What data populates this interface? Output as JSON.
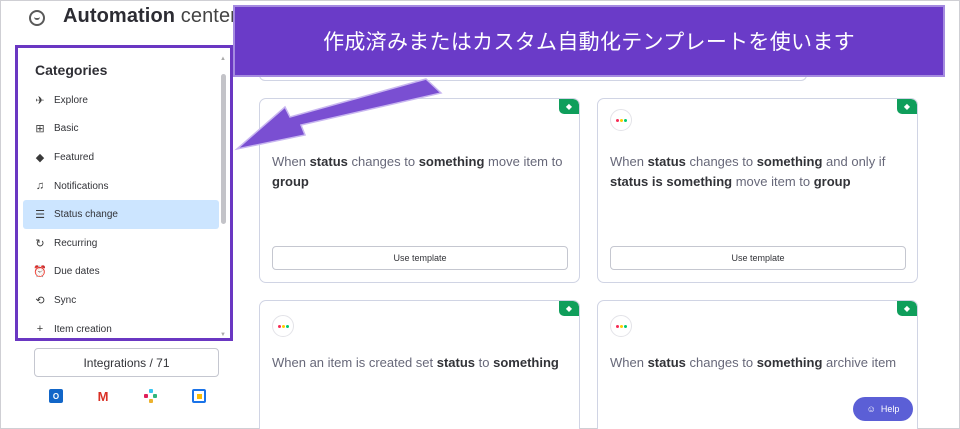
{
  "header": {
    "title_bold": "Automation",
    "title_rest": " center"
  },
  "banner": {
    "text": "作成済みまたはカスタム自動化テンプレートを使います"
  },
  "sidebar": {
    "title": "Categories",
    "items": [
      {
        "label": "Explore",
        "icon": "rocket-icon",
        "glyph": "✈"
      },
      {
        "label": "Basic",
        "icon": "hierarchy-icon",
        "glyph": "⊞"
      },
      {
        "label": "Featured",
        "icon": "diamond-icon",
        "glyph": "◆"
      },
      {
        "label": "Notifications",
        "icon": "bell-icon",
        "glyph": "♫"
      },
      {
        "label": "Status change",
        "icon": "status-list-icon",
        "glyph": "☰",
        "active": true
      },
      {
        "label": "Recurring",
        "icon": "recurring-icon",
        "glyph": "↻"
      },
      {
        "label": "Due dates",
        "icon": "alarm-clock-icon",
        "glyph": "⏰"
      },
      {
        "label": "Sync",
        "icon": "sync-icon",
        "glyph": "⟲"
      },
      {
        "label": "Item creation",
        "icon": "plus-icon",
        "glyph": "+"
      }
    ]
  },
  "integrations": {
    "label": "Integrations / 71"
  },
  "apps": [
    "outlook-icon",
    "gmail-icon",
    "slack-icon",
    "google-calendar-icon"
  ],
  "cards": [
    {
      "parts": [
        [
          "When ",
          false
        ],
        [
          "status",
          true
        ],
        [
          " changes to ",
          false
        ],
        [
          "something",
          true
        ],
        [
          " move item to ",
          false
        ],
        [
          "group",
          true
        ]
      ],
      "button": "Use template"
    },
    {
      "parts": [
        [
          "When ",
          false
        ],
        [
          "status",
          true
        ],
        [
          " changes to ",
          false
        ],
        [
          "something",
          true
        ],
        [
          " and only if ",
          false
        ],
        [
          "status is something",
          true
        ],
        [
          " move item to ",
          false
        ],
        [
          "group",
          true
        ]
      ],
      "button": "Use template"
    },
    {
      "parts": [
        [
          "When an item is created set ",
          false
        ],
        [
          "status",
          true
        ],
        [
          " to ",
          false
        ],
        [
          "something",
          true
        ]
      ]
    },
    {
      "parts": [
        [
          "When ",
          false
        ],
        [
          "status",
          true
        ],
        [
          " changes to ",
          false
        ],
        [
          "something",
          true
        ],
        [
          " archive item",
          false
        ]
      ]
    }
  ],
  "help": {
    "label": "Help"
  },
  "colors": {
    "accent_purple": "#6a3bc8",
    "premium_green": "#0f9e5b",
    "selected_bg": "#cce5ff",
    "help_btn": "#5b5fd6"
  }
}
